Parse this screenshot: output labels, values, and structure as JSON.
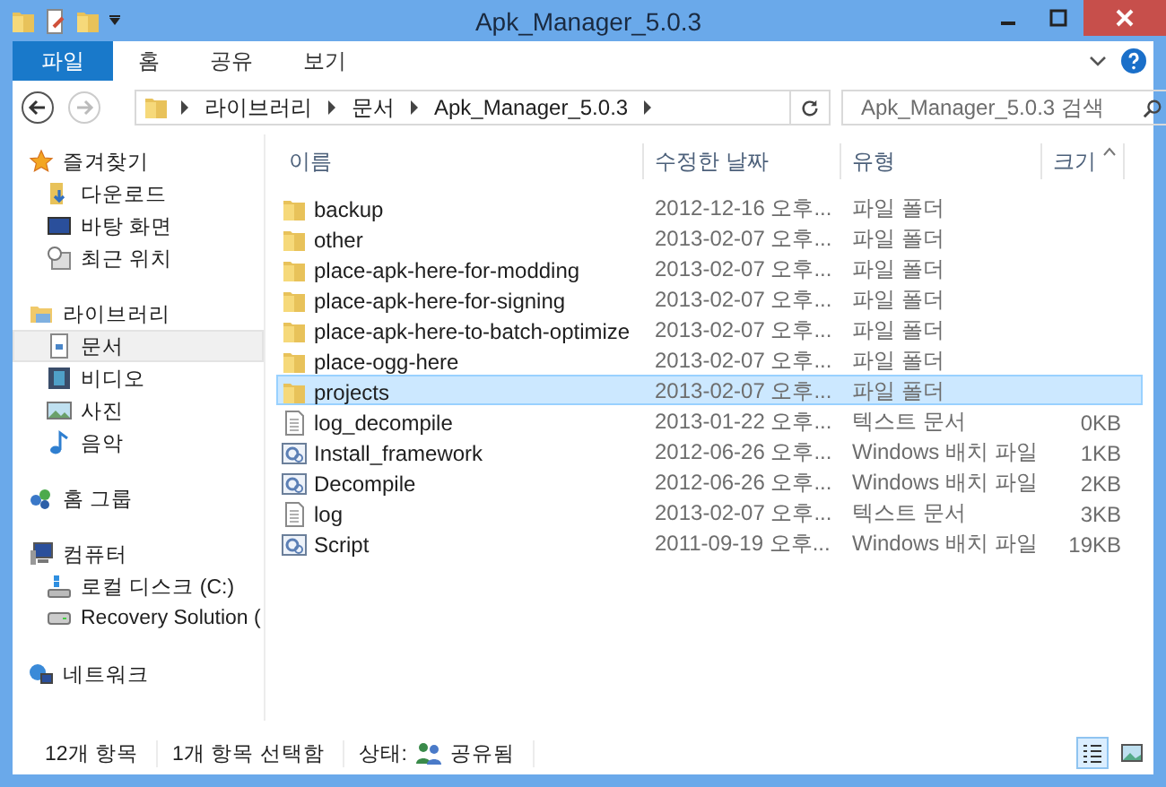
{
  "window": {
    "title": "Apk_Manager_5.0.3"
  },
  "ribbon_tabs": [
    {
      "label": "파일",
      "kind": "file"
    },
    {
      "label": "홈",
      "kind": "tab"
    },
    {
      "label": "공유",
      "kind": "tab"
    },
    {
      "label": "보기",
      "kind": "tab"
    }
  ],
  "address_bar": {
    "path": [
      "라이브러리",
      "문서",
      "Apk_Manager_5.0.3"
    ]
  },
  "search": {
    "placeholder": "Apk_Manager_5.0.3 검색"
  },
  "sidebar": [
    {
      "label": "즐겨찾기",
      "children": [
        {
          "label": "다운로드",
          "selected": false
        },
        {
          "label": "바탕 화면",
          "selected": false
        },
        {
          "label": "최근 위치",
          "selected": false
        }
      ]
    },
    {
      "label": "라이브러리",
      "children": [
        {
          "label": "문서",
          "selected": true
        },
        {
          "label": "비디오",
          "selected": false
        },
        {
          "label": "사진",
          "selected": false
        },
        {
          "label": "음악",
          "selected": false
        }
      ]
    },
    {
      "label": "홈 그룹"
    },
    {
      "label": "컴퓨터",
      "children": [
        {
          "label": "로컬 디스크 (C:)",
          "selected": false
        },
        {
          "label": "Recovery Solution (",
          "selected": false
        }
      ]
    },
    {
      "label": "네트워크"
    }
  ],
  "table": {
    "columns": [
      "이름",
      "수정한 날짜",
      "유형",
      "크기"
    ],
    "rows": [
      {
        "name": "backup",
        "date": "2012-12-16 오후...",
        "type": "파일 폴더",
        "kind": "folder",
        "selected": false
      },
      {
        "name": "other",
        "date": "2013-02-07 오후...",
        "type": "파일 폴더",
        "kind": "folder",
        "selected": false
      },
      {
        "name": "place-apk-here-for-modding",
        "date": "2013-02-07 오후...",
        "type": "파일 폴더",
        "kind": "folder",
        "selected": false
      },
      {
        "name": "place-apk-here-for-signing",
        "date": "2013-02-07 오후...",
        "type": "파일 폴더",
        "kind": "folder",
        "selected": false
      },
      {
        "name": "place-apk-here-to-batch-optimize",
        "date": "2013-02-07 오후...",
        "type": "파일 폴더",
        "kind": "folder",
        "selected": false
      },
      {
        "name": "place-ogg-here",
        "date": "2013-02-07 오후...",
        "type": "파일 폴더",
        "kind": "folder",
        "selected": false
      },
      {
        "name": "projects",
        "date": "2013-02-07 오후...",
        "type": "파일 폴더",
        "kind": "folder",
        "selected": true
      },
      {
        "name": "log_decompile",
        "date": "2013-01-22 오후...",
        "type": "텍스트 문서",
        "size": "0KB",
        "kind": "text",
        "selected": false
      },
      {
        "name": "Install_framework",
        "date": "2012-06-26 오후...",
        "type": "Windows 배치 파일",
        "size": "1KB",
        "kind": "batch",
        "selected": false
      },
      {
        "name": "Decompile",
        "date": "2012-06-26 오후...",
        "type": "Windows 배치 파일",
        "size": "2KB",
        "kind": "batch",
        "selected": false
      },
      {
        "name": "log",
        "date": "2013-02-07 오후...",
        "type": "텍스트 문서",
        "size": "3KB",
        "kind": "text",
        "selected": false
      },
      {
        "name": "Script",
        "date": "2011-09-19 오후...",
        "type": "Windows 배치 파일",
        "size": "19KB",
        "kind": "batch",
        "selected": false
      }
    ]
  },
  "status_bar": {
    "item_count": "12개 항목",
    "selection": "1개 항목 선택함",
    "state_label": "상태:",
    "state_value": "공유됨",
    "views": [
      {
        "kind": "details",
        "selected": true
      },
      {
        "kind": "large_icons",
        "selected": false
      }
    ]
  }
}
